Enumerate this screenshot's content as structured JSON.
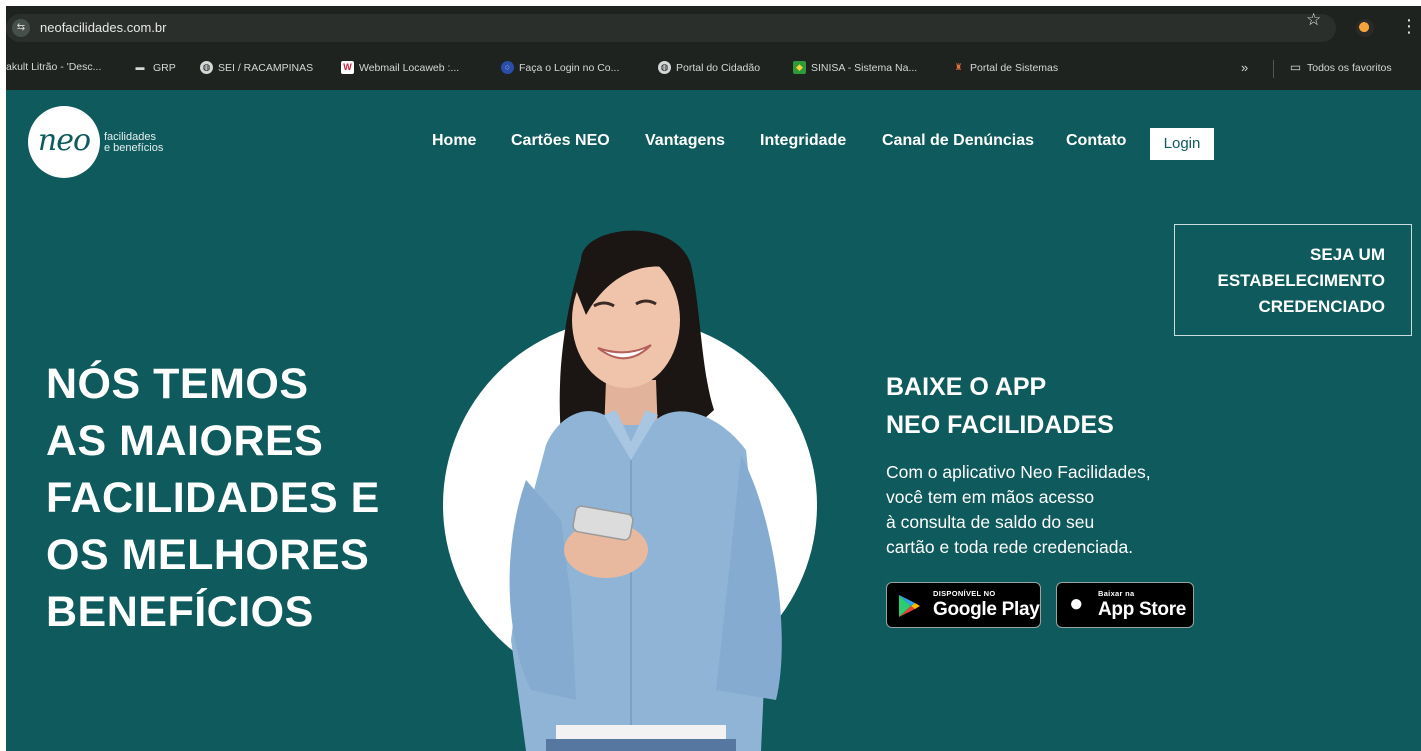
{
  "browser": {
    "url": "neofacilidades.com.br",
    "bookmarks": [
      {
        "label": "akult Litrão - 'Desc...",
        "icon": "none"
      },
      {
        "label": "GRP",
        "icon": "car-icon"
      },
      {
        "label": "SEI / RACAMPINAS",
        "icon": "globe-icon"
      },
      {
        "label": "Webmail Locaweb :...",
        "icon": "webmail-icon"
      },
      {
        "label": "Faça o Login no Co...",
        "icon": "login-icon"
      },
      {
        "label": "Portal do Cidadão",
        "icon": "globe-icon"
      },
      {
        "label": "SINISA - Sistema Na...",
        "icon": "flag-icon"
      },
      {
        "label": "Portal de Sistemas",
        "icon": "tower-icon"
      }
    ],
    "more_bookmarks": "»",
    "all_favorites": "Todos os favoritos"
  },
  "logo": {
    "mark": "neo",
    "line1": "facilidades",
    "line2": "e benefícios"
  },
  "nav": {
    "items": [
      "Home",
      "Cartões NEO",
      "Vantagens",
      "Integridade",
      "Canal de Denúncias",
      "Contato"
    ],
    "login": "Login"
  },
  "cta": {
    "lines": [
      "SEJA UM",
      "ESTABELECIMENTO",
      "CREDENCIADO"
    ]
  },
  "hero": {
    "headline": [
      "NÓS TEMOS",
      "AS MAIORES",
      "FACILIDADES E",
      "OS MELHORES",
      "BENEFÍCIOS"
    ]
  },
  "app": {
    "title": [
      "BAIXE O APP",
      "NEO FACILIDADES"
    ],
    "body": [
      "Com o aplicativo Neo Facilidades,",
      "você tem em mãos acesso",
      "à consulta de saldo do seu",
      "cartão e toda rede credenciada."
    ],
    "google_small": "DISPONÍVEL NO",
    "google_big": "Google Play",
    "apple_small": "Baixar na",
    "apple_big": "App Store"
  },
  "colors": {
    "brand_teal": "#0f5a5c",
    "white": "#ffffff",
    "chrome_dark": "#1f2320"
  }
}
